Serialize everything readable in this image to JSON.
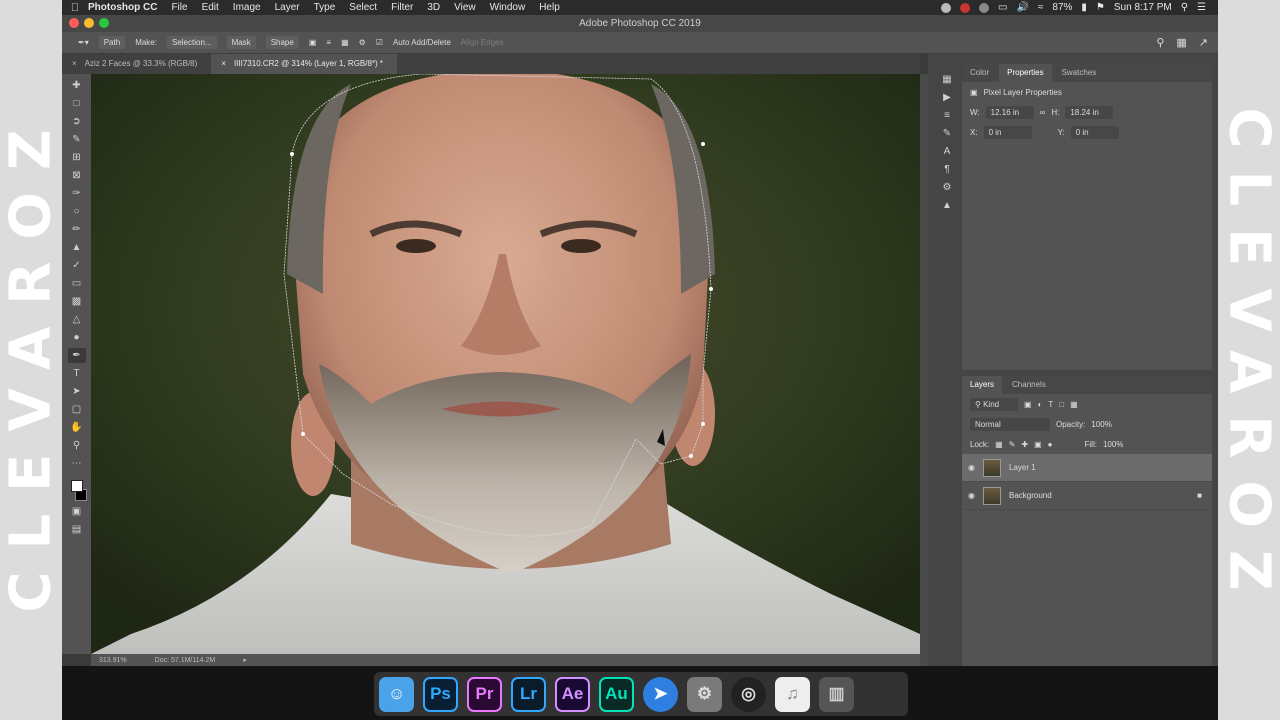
{
  "branding": {
    "left": "CLEVAROZ",
    "right": "CLEVAROZ"
  },
  "menubar": {
    "app_name": "Photoshop CC",
    "items": [
      "File",
      "Edit",
      "Image",
      "Layer",
      "Type",
      "Select",
      "Filter",
      "3D",
      "View",
      "Window",
      "Help"
    ],
    "battery": "87%",
    "clock": "Sun 8:17 PM"
  },
  "window": {
    "title": "Adobe Photoshop CC 2019"
  },
  "options": {
    "mode": "Path",
    "make_label": "Make:",
    "selection": "Selection...",
    "mask": "Mask",
    "shape": "Shape",
    "auto_add_delete": "Auto Add/Delete",
    "align_edges": "Align Edges"
  },
  "tabs": [
    {
      "label": "Aziz 2 Faces @ 33.3% (RGB/8)"
    },
    {
      "label": "IIII7310.CR2 @ 314% (Layer 1, RGB/8*) *"
    }
  ],
  "statusbar": {
    "zoom": "313.91%",
    "doc": "Doc: 57.1M/114.2M"
  },
  "properties": {
    "tabs": [
      "Color",
      "Properties",
      "Swatches"
    ],
    "heading": "Pixel Layer Properties",
    "w_label": "W:",
    "w": "12.16 in",
    "h_label": "H:",
    "h": "18.24 in",
    "x_label": "X:",
    "x": "0 in",
    "y_label": "Y:",
    "y": "0 in"
  },
  "layers": {
    "tabs": [
      "Layers",
      "Channels"
    ],
    "filter": "Kind",
    "blend": "Normal",
    "opacity_label": "Opacity:",
    "opacity": "100%",
    "lock_label": "Lock:",
    "fill_label": "Fill:",
    "fill": "100%",
    "items": [
      {
        "name": "Layer 1"
      },
      {
        "name": "Background"
      }
    ]
  },
  "dock": {
    "apps": [
      {
        "label": "",
        "color": "#4aa3e8"
      },
      {
        "label": "Ps",
        "color": "#0a1f33"
      },
      {
        "label": "Pr",
        "color": "#2a0a33"
      },
      {
        "label": "Lr",
        "color": "#0a1c2a"
      },
      {
        "label": "Ae",
        "color": "#1a0a33"
      },
      {
        "label": "Au",
        "color": "#0a2a26"
      }
    ]
  }
}
